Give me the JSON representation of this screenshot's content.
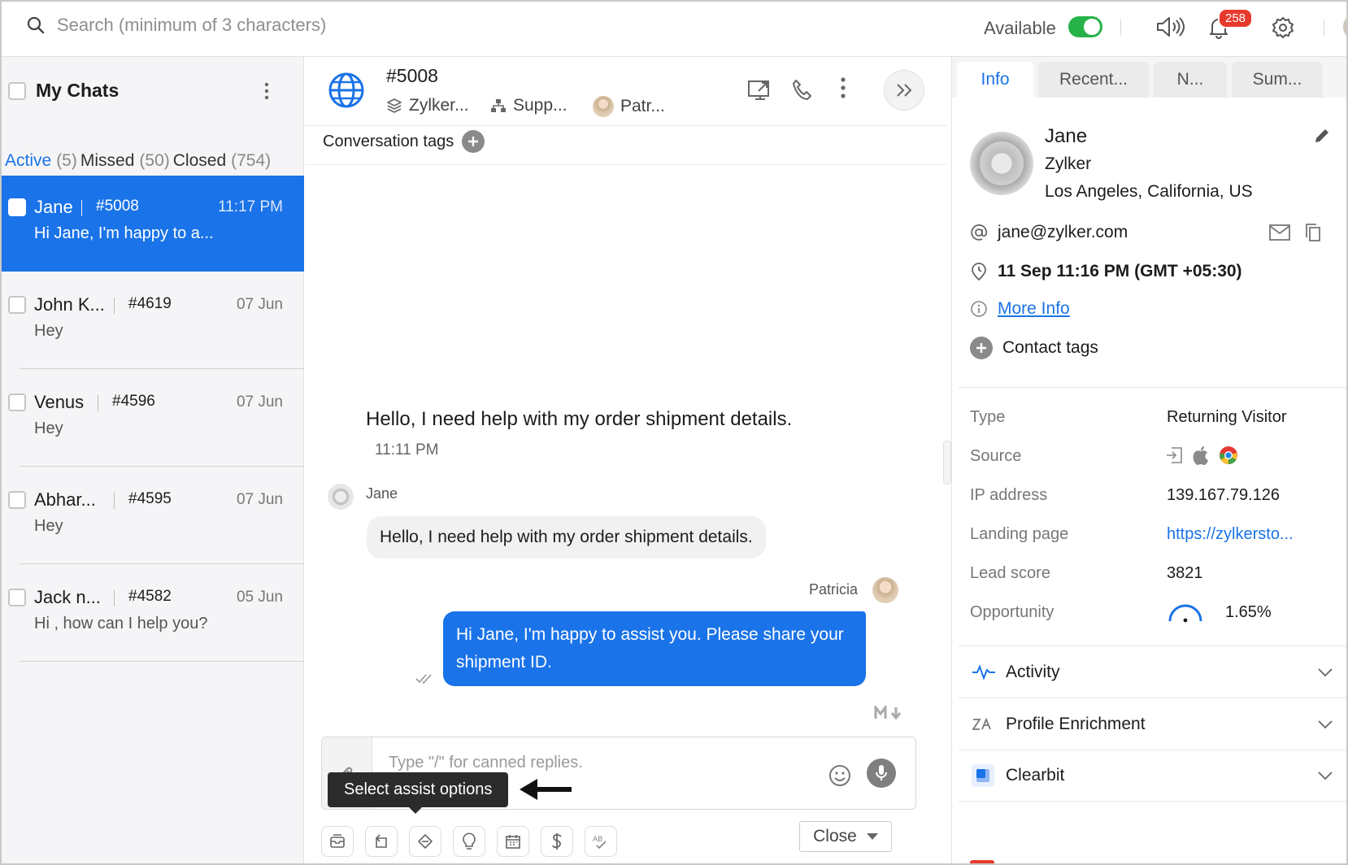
{
  "topbar": {
    "search_placeholder": "Search (minimum of 3 characters)",
    "status_label": "Available",
    "notification_count": "258"
  },
  "left_panel": {
    "title": "My Chats",
    "tabs": [
      {
        "label": "Active",
        "count": "(5)"
      },
      {
        "label": "Missed",
        "count": "(50)"
      },
      {
        "label": "Closed",
        "count": "(754)"
      }
    ],
    "chats": [
      {
        "name": "Jane",
        "id": "#5008",
        "time": "11:17 PM",
        "preview": "Hi Jane, I'm happy to a..."
      },
      {
        "name": "John K...",
        "id": "#4619",
        "time": "07 Jun",
        "preview": "Hey"
      },
      {
        "name": "Venus",
        "id": "#4596",
        "time": "07 Jun",
        "preview": "Hey"
      },
      {
        "name": "Abhar...",
        "id": "#4595",
        "time": "07 Jun",
        "preview": "Hey"
      },
      {
        "name": "Jack n...",
        "id": "#4582",
        "time": "05 Jun",
        "preview": "Hi , how can I help you?"
      }
    ]
  },
  "conversation": {
    "id": "#5008",
    "brand": "Zylker...",
    "department": "Supp...",
    "operator": "Patr...",
    "tags_label": "Conversation tags",
    "question": "Hello, I need help with my order shipment details.",
    "question_time": "11:11 PM",
    "visitor_name": "Jane",
    "visitor_message": "Hello, I need help with my order shipment details.",
    "agent_name": "Patricia",
    "agent_message": "Hi Jane, I'm happy to assist you. Please share your shipment ID.",
    "composer_placeholder": "Type \"/\" for canned replies.",
    "tooltip": "Select assist options",
    "close_label": "Close"
  },
  "right_panel": {
    "tabs": [
      "Info",
      "Recent...",
      "N...",
      "Sum..."
    ],
    "name": "Jane",
    "company": "Zylker",
    "location": "Los Angeles, California, US",
    "email": "jane@zylker.com",
    "local_time": "11 Sep 11:16 PM  (GMT +05:30)",
    "more_info": "More Info",
    "contact_tags": "Contact tags",
    "properties": [
      {
        "label": "Type",
        "value": "Returning Visitor"
      },
      {
        "label": "Source",
        "value": ""
      },
      {
        "label": "IP address",
        "value": "139.167.79.126"
      },
      {
        "label": "Landing page",
        "value": "https://zylkersto..."
      },
      {
        "label": "Lead score",
        "value": "3821"
      },
      {
        "label": "Opportunity",
        "value": "1.65%"
      }
    ],
    "accordions": [
      "Activity",
      "Profile Enrichment",
      "Clearbit"
    ]
  },
  "colors": {
    "accent": "#1a73e8",
    "available": "#27b24a",
    "badge": "#e8392c"
  }
}
